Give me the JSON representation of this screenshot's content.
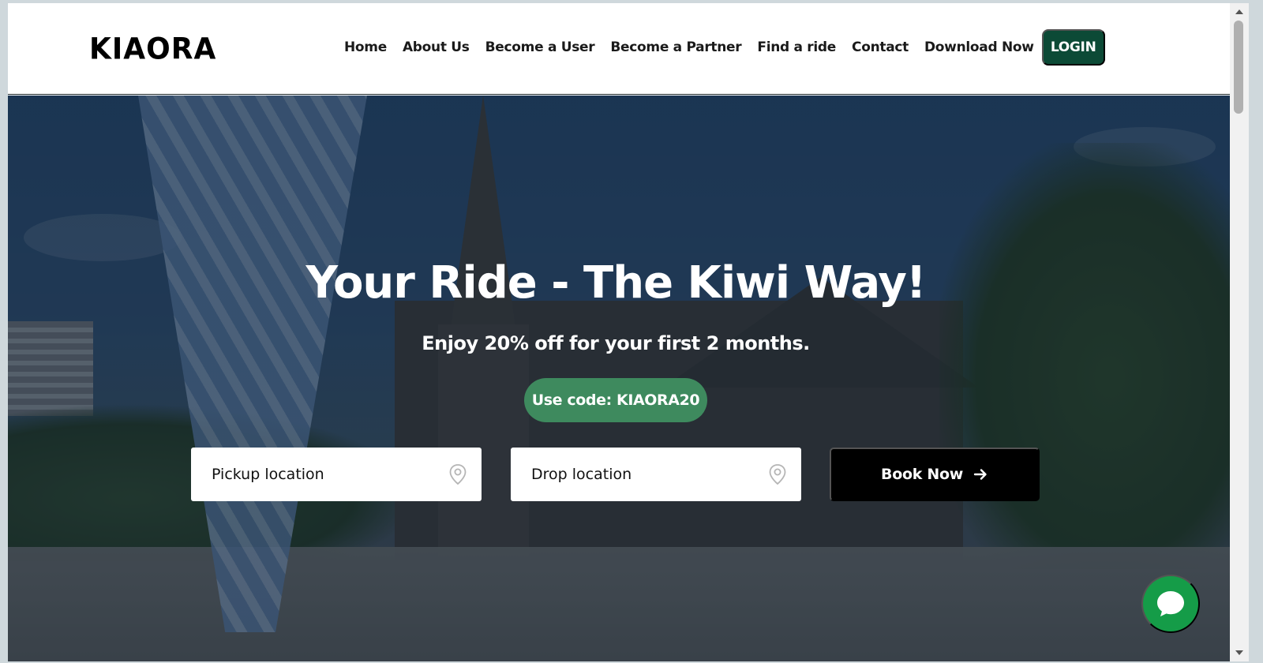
{
  "header": {
    "logo": "KIAORA",
    "nav": [
      {
        "label": "Home"
      },
      {
        "label": "About Us"
      },
      {
        "label": "Become a User"
      },
      {
        "label": "Become a Partner"
      },
      {
        "label": "Find a ride"
      },
      {
        "label": "Contact"
      },
      {
        "label": "Download Now"
      }
    ],
    "login_label": "LOGIN"
  },
  "hero": {
    "title": "Your Ride - The Kiwi Way!",
    "subtitle": "Enjoy 20% off for your first 2 months.",
    "promo": "Use code: KIAORA20",
    "pickup_placeholder": "Pickup location",
    "drop_placeholder": "Drop location",
    "book_label": "Book Now"
  },
  "icons": {
    "pickup": "location-pin-icon",
    "drop": "location-pin-icon",
    "book": "arrow-right-icon",
    "chat": "chat-bubble-icon"
  },
  "colors": {
    "login_bg": "#0c4a36",
    "promo_bg": "#3e8a5e",
    "book_bg": "#000000",
    "chat_bg": "#159c48"
  }
}
